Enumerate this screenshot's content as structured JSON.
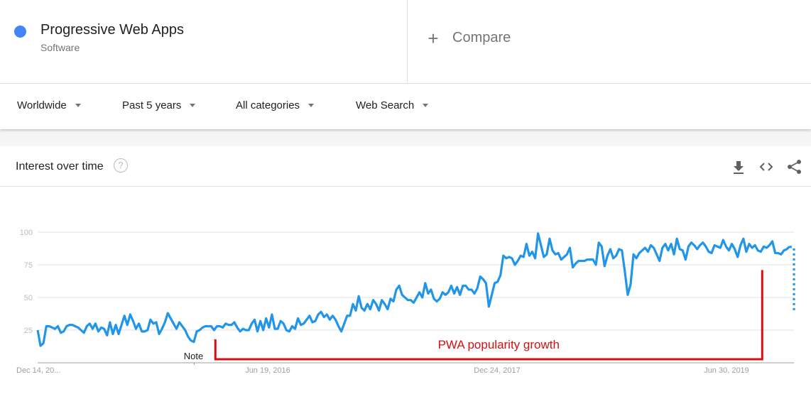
{
  "term": {
    "name": "Progressive Web Apps",
    "category": "Software",
    "color": "#4285f4"
  },
  "compare": {
    "label": "Compare",
    "icon": "plus-icon"
  },
  "filters": [
    {
      "label": "Worldwide"
    },
    {
      "label": "Past 5 years"
    },
    {
      "label": "All categories"
    },
    {
      "label": "Web Search"
    }
  ],
  "card": {
    "title": "Interest over time",
    "help_icon": "?",
    "actions": [
      "download-icon",
      "embed-code-icon",
      "share-icon"
    ]
  },
  "annotation": {
    "label": "PWA popularity growth",
    "color": "#d50f0f",
    "note_label": "Note"
  },
  "chart_data": {
    "type": "line",
    "title": "Interest over time",
    "xlabel": "",
    "ylabel": "",
    "ylim": [
      0,
      100
    ],
    "yticks": [
      25,
      50,
      75,
      100
    ],
    "xtick_labels": [
      "Dec 14, 20...",
      "Jun 19, 2016",
      "Dec 24, 2017",
      "Jun 30, 2019"
    ],
    "grid": true,
    "legend": "none",
    "series": [
      {
        "name": "Progressive Web Apps",
        "color": "#2196e8",
        "values": [
          25,
          13,
          15,
          28,
          28,
          27,
          26,
          28,
          23,
          24,
          28,
          29,
          29,
          28,
          27,
          25,
          23,
          28,
          30,
          26,
          30,
          24,
          27,
          26,
          21,
          31,
          22,
          29,
          22,
          29,
          36,
          29,
          37,
          32,
          26,
          30,
          24,
          24,
          25,
          33,
          30,
          31,
          22,
          26,
          31,
          38,
          34,
          30,
          26,
          31,
          28,
          25,
          20,
          17,
          16,
          24,
          25,
          27,
          28,
          28,
          28,
          25,
          28,
          28,
          27,
          30,
          29,
          29,
          31,
          27,
          24,
          26,
          25,
          25,
          30,
          33,
          24,
          32,
          25,
          34,
          27,
          37,
          26,
          26,
          32,
          30,
          25,
          24,
          28,
          26,
          34,
          29,
          30,
          33,
          36,
          31,
          32,
          37,
          39,
          35,
          37,
          33,
          36,
          33,
          28,
          24,
          30,
          36,
          36,
          45,
          40,
          51,
          42,
          40,
          45,
          41,
          48,
          45,
          40,
          48,
          45,
          41,
          49,
          47,
          56,
          59,
          52,
          50,
          48,
          48,
          46,
          50,
          54,
          50,
          61,
          53,
          56,
          49,
          47,
          49,
          54,
          52,
          54,
          59,
          53,
          58,
          52,
          59,
          59,
          56,
          56,
          53,
          57,
          66,
          64,
          61,
          43,
          52,
          61,
          62,
          67,
          82,
          80,
          81,
          80,
          75,
          78,
          82,
          81,
          91,
          82,
          85,
          80,
          99,
          90,
          81,
          83,
          95,
          86,
          83,
          84,
          79,
          81,
          83,
          88,
          73,
          76,
          78,
          78,
          78,
          79,
          79,
          79,
          75,
          92,
          89,
          74,
          82,
          87,
          80,
          82,
          87,
          86,
          70,
          52,
          60,
          83,
          80,
          84,
          86,
          88,
          85,
          90,
          88,
          83,
          78,
          88,
          91,
          86,
          91,
          83,
          95,
          87,
          86,
          79,
          89,
          92,
          90,
          87,
          90,
          92,
          89,
          85,
          84,
          90,
          89,
          88,
          94,
          89,
          86,
          91,
          87,
          81,
          90,
          95,
          85,
          91,
          88,
          90,
          86,
          85,
          89,
          88,
          90,
          93,
          84,
          84,
          83,
          86,
          87,
          89
        ],
        "partial_last_value": 40
      }
    ],
    "annotations": [
      {
        "type": "bracket",
        "label": "PWA popularity growth",
        "from_fraction": 0.235,
        "to_fraction": 0.958,
        "right_top_value": 71
      },
      {
        "type": "note",
        "label": "Note",
        "at_fraction": 0.207
      }
    ]
  }
}
